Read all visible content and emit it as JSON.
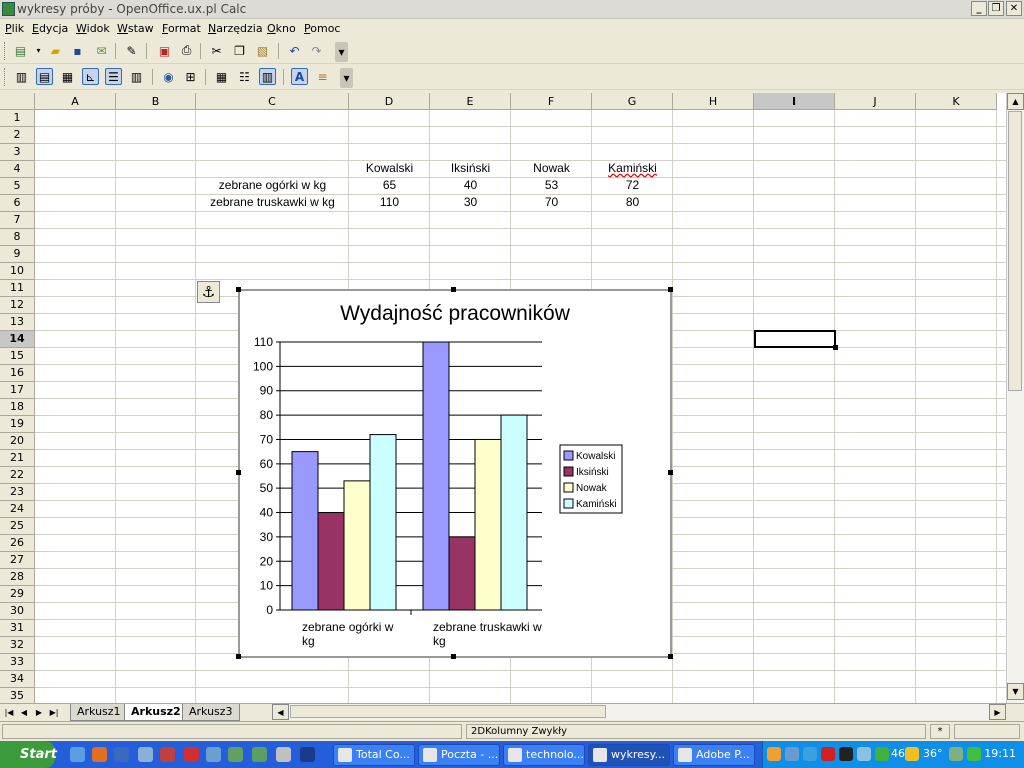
{
  "window": {
    "title": "wykresy próby - OpenOffice.ux.pl Calc"
  },
  "menu": [
    "Plik",
    "Edycja",
    "Widok",
    "Wstaw",
    "Format",
    "Narzędzia",
    "Okno",
    "Pomoc"
  ],
  "columns": [
    "A",
    "B",
    "C",
    "D",
    "E",
    "F",
    "G",
    "H",
    "I",
    "J",
    "K"
  ],
  "selected_column": "I",
  "rows": [
    "1",
    "2",
    "3",
    "4",
    "5",
    "6",
    "7",
    "8",
    "9",
    "10",
    "11",
    "12",
    "13",
    "14",
    "15",
    "16",
    "17",
    "18",
    "19",
    "20",
    "21",
    "22",
    "23",
    "24",
    "25",
    "26",
    "27",
    "28",
    "29",
    "30",
    "31",
    "32",
    "33",
    "34",
    "35"
  ],
  "selected_row": "14",
  "sheet": {
    "headers": [
      "Kowalski",
      "Iksiński",
      "Nowak",
      "Kamiński"
    ],
    "row5": {
      "label": "zebrane ogórki w kg",
      "values": [
        "65",
        "40",
        "53",
        "72"
      ]
    },
    "row6": {
      "label": "zebrane truskawki w kg",
      "values": [
        "110",
        "30",
        "70",
        "80"
      ]
    }
  },
  "chart_data": {
    "type": "bar",
    "title": "Wydajność pracowników",
    "categories": [
      "zebrane ogórki w kg",
      "zebrane truskawki w kg"
    ],
    "series": [
      {
        "name": "Kowalski",
        "values": [
          65,
          110
        ],
        "color": "#9999ff"
      },
      {
        "name": "Iksiński",
        "values": [
          40,
          30
        ],
        "color": "#993366"
      },
      {
        "name": "Nowak",
        "values": [
          53,
          70
        ],
        "color": "#ffffcc"
      },
      {
        "name": "Kamiński",
        "values": [
          72,
          80
        ],
        "color": "#ccffff"
      }
    ],
    "ylim": [
      0,
      110
    ],
    "yticks": [
      0,
      10,
      20,
      30,
      40,
      50,
      60,
      70,
      80,
      90,
      100,
      110
    ],
    "legend": "right",
    "grid": true
  },
  "tabs": [
    "Arkusz1",
    "Arkusz2",
    "Arkusz3"
  ],
  "active_tab": "Arkusz2",
  "status": {
    "chart_type": "2DKolumny Zwykły",
    "modified": "*"
  },
  "taskbar": {
    "start": "Start",
    "tasks": [
      "Total Co...",
      "Poczta - ...",
      "technolo...",
      "wykresy...",
      "Adobe P..."
    ],
    "tray_temp": "36°",
    "tray_num": "46",
    "clock": "19:11"
  }
}
